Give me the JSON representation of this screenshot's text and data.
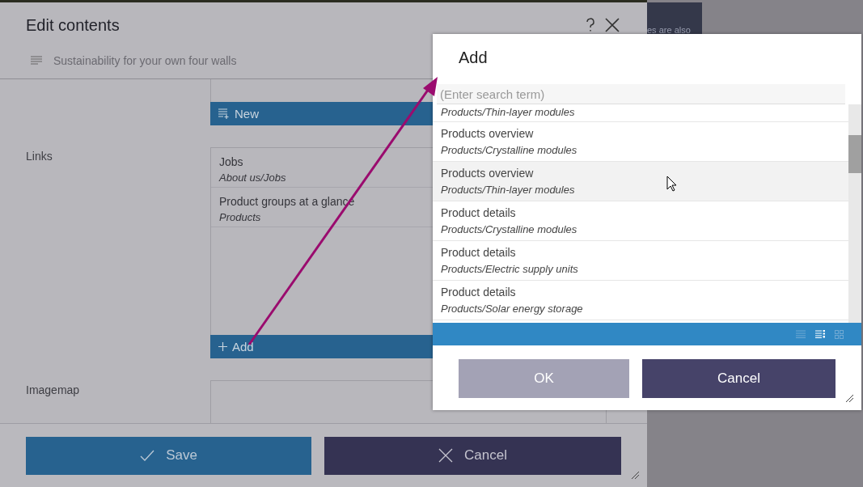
{
  "background": {
    "text_fragment": "es are also"
  },
  "editor": {
    "title": "Edit contents",
    "subtitle": "Sustainability for your own four walls",
    "new_button": "New",
    "fields": [
      {
        "label": "Links",
        "items": [
          {
            "title": "Jobs",
            "path": "About us/Jobs"
          },
          {
            "title": "Product groups at a glance",
            "path": "Products"
          }
        ],
        "add_button": "Add"
      },
      {
        "label": "Imagemap"
      }
    ],
    "save_button": "Save",
    "cancel_button": "Cancel"
  },
  "add_dialog": {
    "title": "Add",
    "search": {
      "placeholder": "(Enter search term)"
    },
    "items": [
      {
        "path": "Products/Thin-layer modules",
        "selected": false
      },
      {
        "title": "Products overview",
        "path": "Products/Crystalline modules",
        "selected": false
      },
      {
        "title": "Products overview",
        "path": "Products/Thin-layer modules",
        "selected": true
      },
      {
        "title": "Product details",
        "path": "Products/Crystalline modules",
        "selected": false
      },
      {
        "title": "Product details",
        "path": "Products/Electric supply units",
        "selected": false
      },
      {
        "title": "Product details",
        "path": "Products/Solar energy storage",
        "selected": false
      }
    ],
    "views": [
      {
        "kind": "list",
        "selected": false
      },
      {
        "kind": "details",
        "selected": true
      },
      {
        "kind": "grid",
        "selected": false
      }
    ],
    "ok_button": "OK",
    "cancel_button": "Cancel"
  }
}
